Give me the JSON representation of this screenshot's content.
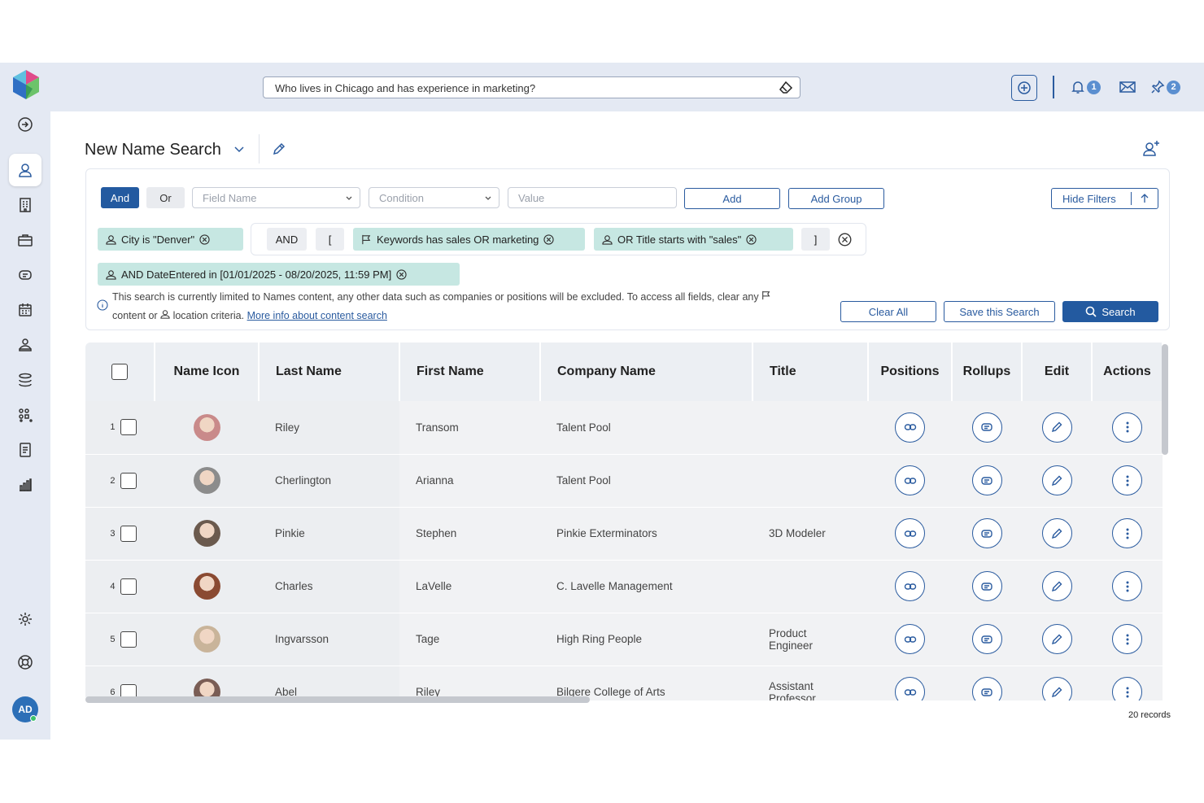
{
  "topbar": {
    "search_value": "Who lives in Chicago and has experience in marketing?",
    "notifications_count": "1",
    "pins_count": "2"
  },
  "sidebar": {
    "items": [
      {
        "icon": "arrow-right-circle-icon"
      },
      {
        "icon": "person-icon",
        "active": true
      },
      {
        "icon": "building-icon"
      },
      {
        "icon": "briefcase-icon"
      },
      {
        "icon": "tag-icon"
      },
      {
        "icon": "calendar-icon"
      },
      {
        "icon": "hand-icon"
      },
      {
        "icon": "rollup-icon"
      },
      {
        "icon": "grid-icon"
      },
      {
        "icon": "document-icon"
      },
      {
        "icon": "bar-chart-icon"
      }
    ],
    "settings_icon": "gear-icon",
    "help_icon": "lifebuoy-icon",
    "user_initials": "AD"
  },
  "page": {
    "title": "New Name Search"
  },
  "filters": {
    "and_label": "And",
    "or_label": "Or",
    "field_placeholder": "Field Name",
    "condition_placeholder": "Condition",
    "value_placeholder": "Value",
    "add_label": "Add",
    "add_group_label": "Add Group",
    "hide_filters_label": "Hide Filters",
    "chips": {
      "city": "City is \"Denver\"",
      "and_op": "AND",
      "open_bracket": "[",
      "keywords": "Keywords has sales OR marketing",
      "title": "OR Title starts with \"sales\"",
      "close_bracket": "]",
      "date": "AND DateEntered in [01/01/2025 - 08/20/2025, 11:59 PM]"
    },
    "info_line1": "This search is currently limited to Names content, any other data such as companies or positions will be excluded. To access all fields, clear any",
    "info_line2a": "content or",
    "info_line2b": "location criteria.",
    "info_link": "More info about content search",
    "clear_all_label": "Clear All",
    "save_search_label": "Save this Search",
    "search_label": "Search"
  },
  "table": {
    "headers": {
      "name_icon": "Name Icon",
      "last_name": "Last Name",
      "first_name": "First Name",
      "company": "Company Name",
      "title": "Title",
      "positions": "Positions",
      "rollups": "Rollups",
      "edit": "Edit",
      "actions": "Actions"
    },
    "rows": [
      {
        "num": "1",
        "last": "Riley",
        "first": "Transom",
        "company": "Talent Pool",
        "title": "",
        "face": "#c98a8a"
      },
      {
        "num": "2",
        "last": "Cherlington",
        "first": "Arianna",
        "company": "Talent Pool",
        "title": "",
        "face": "#8c8c8c"
      },
      {
        "num": "3",
        "last": "Pinkie",
        "first": "Stephen",
        "company": "Pinkie Exterminators",
        "title": "3D Modeler",
        "face": "#6b5a4e"
      },
      {
        "num": "4",
        "last": "Charles",
        "first": "LaVelle",
        "company": "C. Lavelle Management",
        "title": "",
        "face": "#8a4a32"
      },
      {
        "num": "5",
        "last": "Ingvarsson",
        "first": "Tage",
        "company": "High Ring People",
        "title": "Product Engineer",
        "face": "#c9b49a"
      },
      {
        "num": "6",
        "last": "Abel",
        "first": "Riley",
        "company": "Bilgere College of Arts",
        "title": "Assistant Professor",
        "face": "#7a5d55"
      }
    ],
    "records_label": "20 records"
  },
  "colors": {
    "primary": "#235aa0",
    "chip": "#c6e7e2",
    "topbar": "#e4e9f3"
  }
}
